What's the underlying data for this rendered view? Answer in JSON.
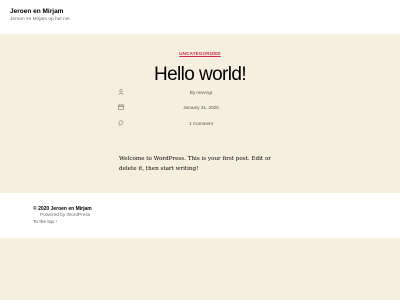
{
  "header": {
    "site_title": "Jeroen en Mirjam",
    "site_description": "Jeroen en Mirjam op het net"
  },
  "post": {
    "category": "UNCATEGORIZED",
    "title": "Hello world!",
    "meta": {
      "author": "By mwvngt",
      "date": "January 31, 2020",
      "comments": "1 Comment"
    },
    "body": "Welcome to WordPress. This is your first post. Edit or delete it, then start writing!"
  },
  "footer": {
    "copyright": "© 2020 Jeroen en Mirjam",
    "powered_by": "Powered by WordPress",
    "to_top": "To the top ↑"
  },
  "colors": {
    "background": "#f5efe0",
    "accent": "#cd2653",
    "header_footer_bg": "#ffffff"
  },
  "icons": {
    "author": "user-icon",
    "date": "calendar-icon",
    "comments": "comment-icon"
  }
}
